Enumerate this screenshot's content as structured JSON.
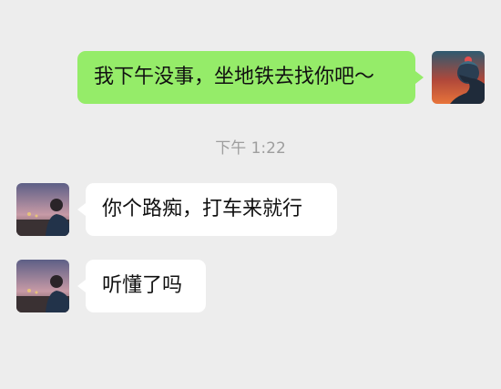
{
  "chat": {
    "timestamp": "下午 1:22",
    "messages": [
      {
        "direction": "outgoing",
        "text": "我下午没事，坐地铁去找你吧～",
        "avatar": "self-avatar-icon"
      },
      {
        "direction": "incoming",
        "text": "你个路痴，打车来就行",
        "avatar": "contact-avatar-icon"
      },
      {
        "direction": "incoming",
        "text": "听懂了吗",
        "avatar": "contact-avatar-icon"
      }
    ]
  },
  "colors": {
    "background": "#ededed",
    "outgoing_bubble": "#95ec69",
    "incoming_bubble": "#ffffff",
    "timestamp_text": "#9e9e9e"
  }
}
